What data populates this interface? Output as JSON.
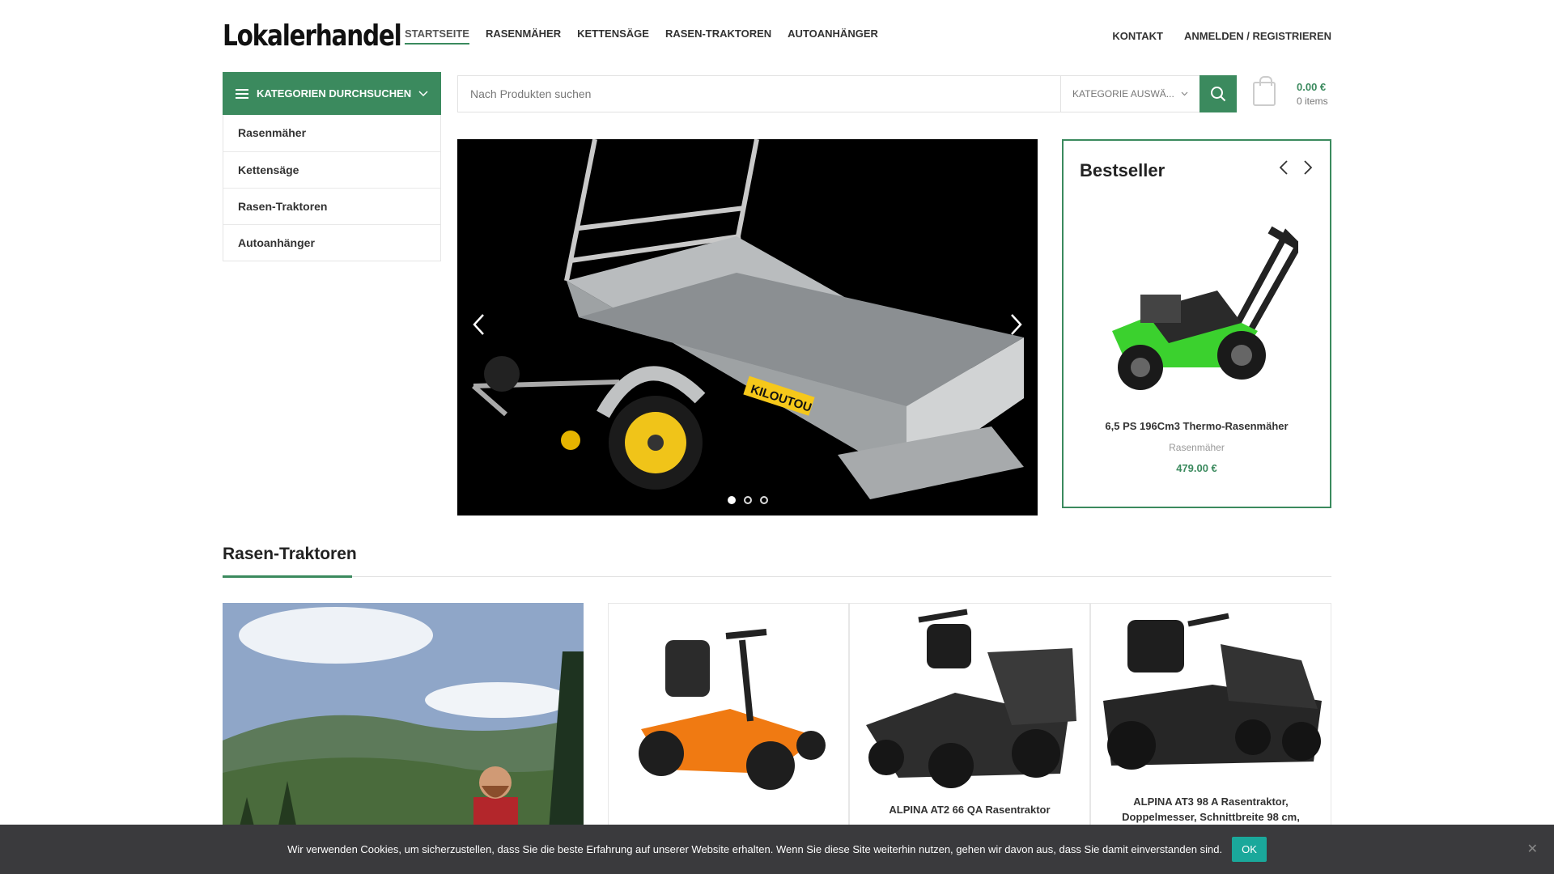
{
  "logo": "Lokalerhandel",
  "nav": [
    "STARTSEITE",
    "RASENMÄHER",
    "KETTENSÄGE",
    "RASEN-TRAKTOREN",
    "AUTOANHÄNGER"
  ],
  "nav_right": {
    "contact": "KONTAKT",
    "login": "ANMELDEN / REGISTRIEREN"
  },
  "categories": {
    "header": "KATEGORIEN DURCHSUCHEN",
    "items": [
      "Rasenmäher",
      "Kettensäge",
      "Rasen-Traktoren",
      "Autoanhänger"
    ]
  },
  "search": {
    "placeholder": "Nach Produkten suchen",
    "category_select": "KATEGORIE AUSWÄ..."
  },
  "cart": {
    "total": "0.00 €",
    "items": "0 items"
  },
  "slider": {
    "slide_count": 3,
    "active_slide": 1,
    "trailer_brand": "KILOUTOU"
  },
  "bestseller": {
    "title": "Bestseller",
    "product": {
      "name": "6,5 PS 196Cm3 Thermo-Rasenmäher",
      "category": "Rasenmäher",
      "price": "479.00 €"
    }
  },
  "section": {
    "title": "Rasen-Traktoren",
    "products": [
      {
        "title": ""
      },
      {
        "title": "ALPINA AT2 66 QA Rasentraktor"
      },
      {
        "title": "ALPINA AT3 98 A Rasentraktor, Doppelmesser, Schnittbreite 98 cm,"
      }
    ]
  },
  "cookie": {
    "text": "Wir verwenden Cookies, um sicherzustellen, dass Sie die beste Erfahrung auf unserer Website erhalten. Wenn Sie diese Site weiterhin nutzen, gehen wir davon aus, dass Sie damit einverstanden sind.",
    "ok": "OK"
  },
  "colors": {
    "accent": "#3b8a5e",
    "cookie_bg": "#3a3a3d",
    "cookie_ok": "#1aa89b"
  }
}
